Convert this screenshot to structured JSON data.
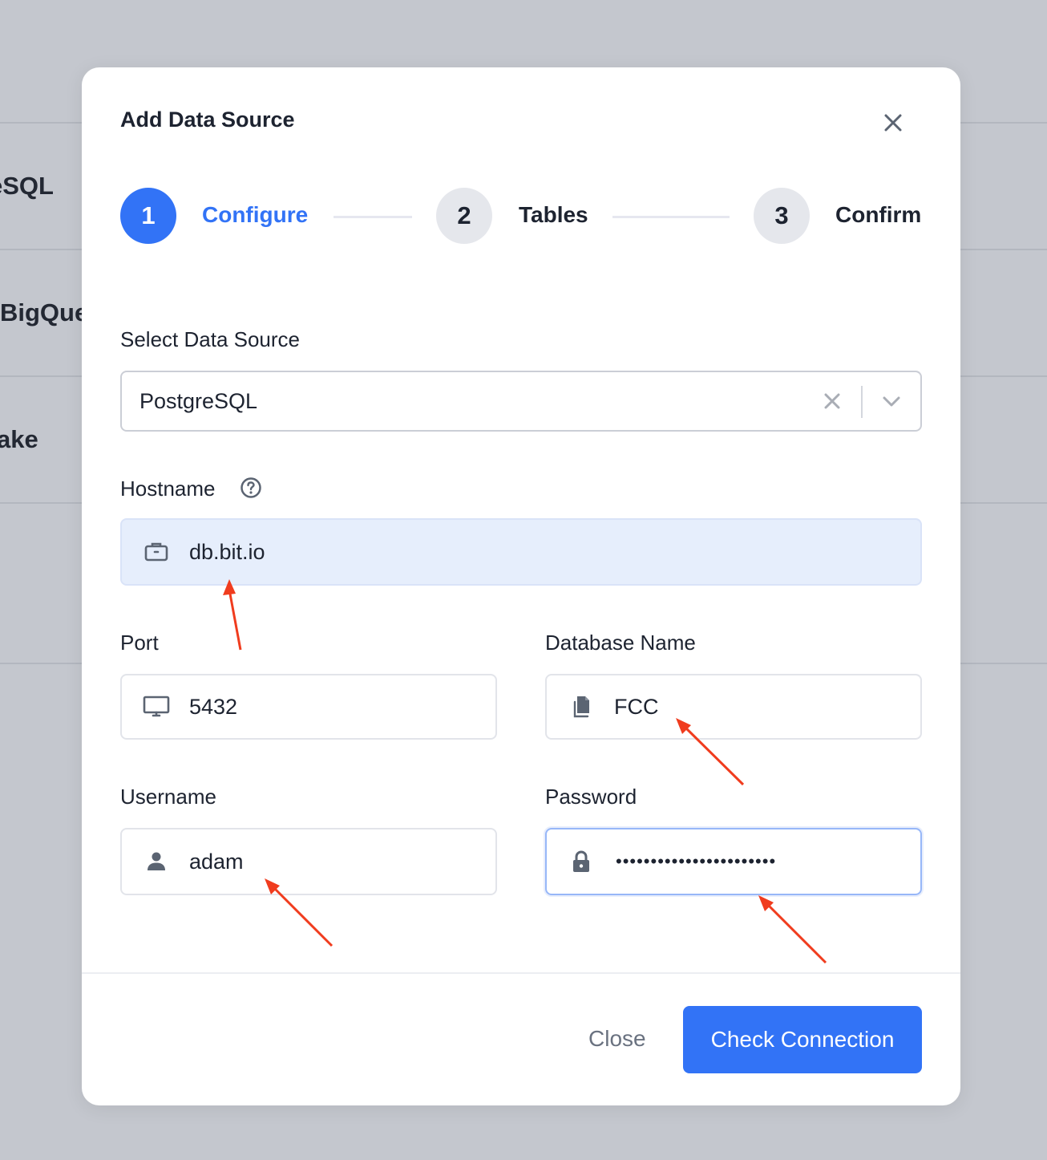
{
  "background": {
    "rows": [
      {
        "label": "eSQL"
      },
      {
        "label": "BigQue"
      },
      {
        "label": "ake"
      }
    ]
  },
  "modal": {
    "title": "Add Data Source",
    "close_icon": "close-icon"
  },
  "stepper": {
    "steps": [
      {
        "number": "1",
        "label": "Configure",
        "state": "active"
      },
      {
        "number": "2",
        "label": "Tables",
        "state": "pending"
      },
      {
        "number": "3",
        "label": "Confirm",
        "state": "pending"
      }
    ]
  },
  "form": {
    "data_source": {
      "label": "Select Data Source",
      "value": "PostgreSQL"
    },
    "hostname": {
      "label": "Hostname",
      "value": "db.bit.io",
      "icon": "briefcase-icon",
      "help_icon": "help-circle-icon"
    },
    "port": {
      "label": "Port",
      "value": "5432",
      "icon": "monitor-icon"
    },
    "database_name": {
      "label": "Database Name",
      "value": "FCC",
      "icon": "documents-icon"
    },
    "username": {
      "label": "Username",
      "value": "adam",
      "icon": "user-icon"
    },
    "password": {
      "label": "Password",
      "value": "•••••••••••••••••••••••",
      "icon": "lock-icon"
    }
  },
  "footer": {
    "close_label": "Close",
    "check_label": "Check Connection"
  },
  "colors": {
    "accent": "#3273f6",
    "annotation": "#f03c1e",
    "hostname_bg": "#e6eefc",
    "overlay": "#c4c7ce"
  }
}
